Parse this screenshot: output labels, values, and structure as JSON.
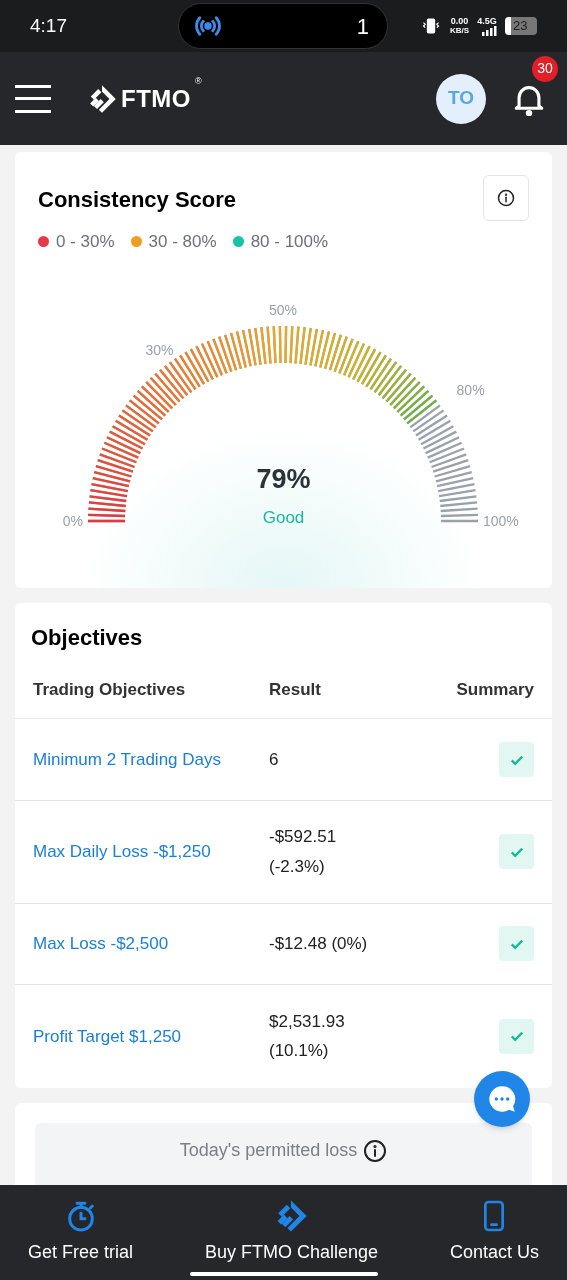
{
  "status_bar": {
    "time": "4:17",
    "pill_count": "1",
    "net_speed": "0.00",
    "net_unit": "KB/S",
    "network": "4.5G",
    "battery": "23"
  },
  "header": {
    "logo": "FTMO",
    "logo_mark": "®",
    "avatar": "TO",
    "notifications": "30"
  },
  "consistency": {
    "title": "Consistency Score",
    "legend": [
      {
        "label": "0 - 30%",
        "color": "#e8394a"
      },
      {
        "label": "30 - 80%",
        "color": "#f29d1f"
      },
      {
        "label": "80 - 100%",
        "color": "#17c3a5"
      }
    ],
    "gauge": {
      "value": "79%",
      "rating": "Good",
      "scale_labels": [
        "0%",
        "30%",
        "50%",
        "80%",
        "100%"
      ]
    }
  },
  "objectives": {
    "title": "Objectives",
    "columns": [
      "Trading Objectives",
      "Result",
      "Summary"
    ],
    "rows": [
      {
        "name": "Minimum 2 Trading Days",
        "result": [
          "6"
        ],
        "passed": true
      },
      {
        "name": "Max Daily Loss -$1,250",
        "result": [
          "-$592.51",
          "(-2.3%)"
        ],
        "passed": true
      },
      {
        "name": "Max Loss -$2,500",
        "result": [
          "-$12.48 (0%)"
        ],
        "passed": true
      },
      {
        "name": "Profit Target $1,250",
        "result": [
          "$2,531.93",
          "(10.1%)"
        ],
        "passed": true
      }
    ]
  },
  "permitted_loss": {
    "label": "Today's permitted loss"
  },
  "bottom_nav": [
    {
      "label": "Get Free trial",
      "kind": "timer"
    },
    {
      "label": "Buy FTMO Challenge",
      "kind": "logo"
    },
    {
      "label": "Contact Us",
      "kind": "phone"
    }
  ]
}
